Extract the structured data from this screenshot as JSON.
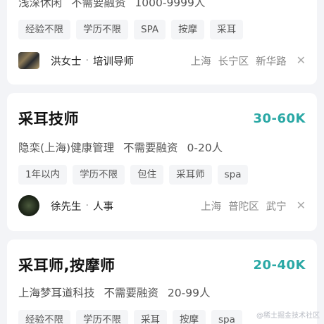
{
  "cards": [
    {
      "company_parts": [
        "浅深休闲",
        "不需要融资",
        "1000-9999人"
      ],
      "tags": [
        "经验不限",
        "学历不限",
        "SPA",
        "按摩",
        "采耳"
      ],
      "recruiter": {
        "name": "洪女士",
        "role": "培训导师"
      },
      "location": [
        "上海",
        "长宁区",
        "新华路"
      ]
    },
    {
      "title": "采耳技师",
      "salary": "30-60K",
      "company_parts": [
        "隐栾(上海)健康管理",
        "不需要融资",
        "0-20人"
      ],
      "tags": [
        "1年以内",
        "学历不限",
        "包住",
        "采耳师",
        "spa"
      ],
      "recruiter": {
        "name": "徐先生",
        "role": "人事"
      },
      "location": [
        "上海",
        "普陀区",
        "武宁"
      ]
    },
    {
      "title": "采耳师,按摩师",
      "salary": "20-40K",
      "company_parts": [
        "上海梦耳道科技",
        "不需要融资",
        "20-99人"
      ],
      "tags": [
        "经验不限",
        "学历不限",
        "采耳",
        "按摩",
        "spa"
      ]
    }
  ],
  "separator": "·",
  "close_glyph": "✕",
  "watermark": "@稀土掘金技术社区",
  "colors": {
    "salary": "#2aa8a5",
    "background": "#f3f4f7",
    "tag_bg": "#f4f5f7"
  }
}
